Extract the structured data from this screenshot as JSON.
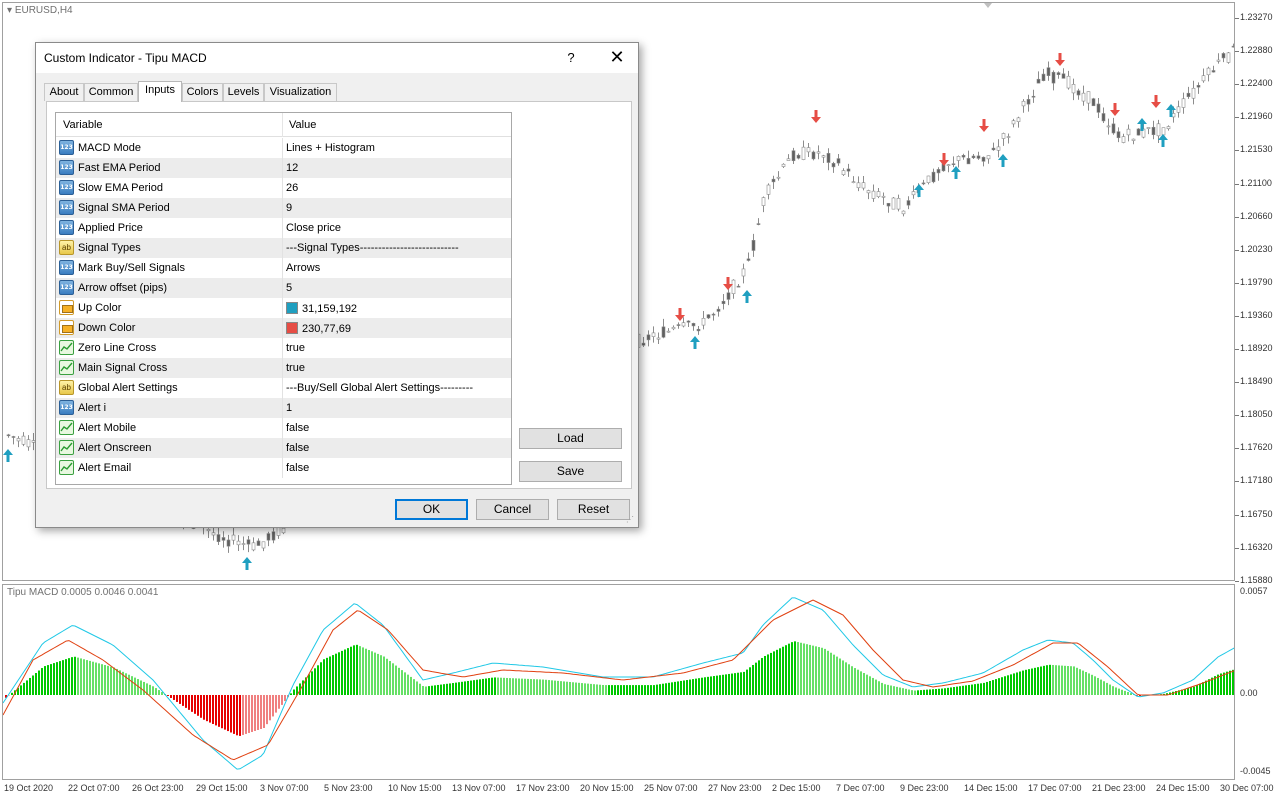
{
  "chart_window": {
    "symbol_label": "EURUSD,H4",
    "indicator_label": "Tipu MACD 0.0005 0.0046 0.0041",
    "price_axis": [
      "1.23270",
      "1.22880",
      "1.22400",
      "1.21960",
      "1.21530",
      "1.21100",
      "1.20660",
      "1.20230",
      "1.19790",
      "1.19360",
      "1.18920",
      "1.18490",
      "1.18050",
      "1.17620",
      "1.17180",
      "1.16750",
      "1.16320",
      "1.15880"
    ],
    "indicator_axis": [
      "0.0057",
      "0.00",
      "-0.0045"
    ],
    "time_axis": [
      "19 Oct 2020",
      "22 Oct 07:00",
      "26 Oct 23:00",
      "29 Oct 15:00",
      "3 Nov 07:00",
      "5 Nov 23:00",
      "10 Nov 15:00",
      "13 Nov 07:00",
      "17 Nov 23:00",
      "20 Nov 15:00",
      "25 Nov 07:00",
      "27 Nov 23:00",
      "2 Dec 15:00",
      "7 Dec 07:00",
      "9 Dec 23:00",
      "14 Dec 15:00",
      "17 Dec 07:00",
      "21 Dec 23:00",
      "24 Dec 15:00",
      "30 Dec 07:00"
    ],
    "colors": {
      "up_arrow": "#1f9fc0",
      "down_arrow": "#e64d45",
      "hist_up_strong": "#00c800",
      "hist_up_weak": "#66e066",
      "hist_down_strong": "#e60000",
      "hist_down_weak": "#f08080",
      "macd_line": "#1fc8e6",
      "signal_line": "#e04010",
      "candles": "#8c8c8c"
    }
  },
  "dialog": {
    "title": "Custom Indicator - Tipu MACD",
    "help_label": "?",
    "close_label": "✕",
    "tabs": [
      {
        "label": "About",
        "active": false
      },
      {
        "label": "Common",
        "active": false
      },
      {
        "label": "Inputs",
        "active": true
      },
      {
        "label": "Colors",
        "active": false
      },
      {
        "label": "Levels",
        "active": false
      },
      {
        "label": "Visualization",
        "active": false
      }
    ],
    "grid": {
      "header_variable": "Variable",
      "header_value": "Value",
      "rows": [
        {
          "icon": "number-icon",
          "variable": "MACD Mode",
          "value": "Lines + Histogram"
        },
        {
          "icon": "number-icon",
          "variable": "Fast EMA Period",
          "value": "12"
        },
        {
          "icon": "number-icon",
          "variable": "Slow EMA Period",
          "value": "26"
        },
        {
          "icon": "number-icon",
          "variable": "Signal SMA Period",
          "value": "9"
        },
        {
          "icon": "number-icon",
          "variable": "Applied Price",
          "value": "Close price"
        },
        {
          "icon": "string-icon",
          "variable": "Signal Types",
          "value": "---Signal Types---------------------------"
        },
        {
          "icon": "number-icon",
          "variable": "Mark Buy/Sell Signals",
          "value": "Arrows"
        },
        {
          "icon": "number-icon",
          "variable": "Arrow offset (pips)",
          "value": "5"
        },
        {
          "icon": "color-icon",
          "variable": "Up Color",
          "value": "31,159,192",
          "swatch": "#1f9fc0"
        },
        {
          "icon": "color-icon",
          "variable": "Down Color",
          "value": "230,77,69",
          "swatch": "#e64d45"
        },
        {
          "icon": "bool-icon",
          "variable": "Zero Line Cross",
          "value": "true"
        },
        {
          "icon": "bool-icon",
          "variable": "Main Signal Cross",
          "value": "true"
        },
        {
          "icon": "string-icon",
          "variable": "Global Alert Settings",
          "value": "---Buy/Sell Global Alert Settings---------"
        },
        {
          "icon": "number-icon",
          "variable": "Alert i",
          "value": "1"
        },
        {
          "icon": "bool-icon",
          "variable": "Alert Mobile",
          "value": "false"
        },
        {
          "icon": "bool-icon",
          "variable": "Alert Onscreen",
          "value": "false"
        },
        {
          "icon": "bool-icon",
          "variable": "Alert Email",
          "value": "false"
        }
      ]
    },
    "buttons": {
      "load": "Load",
      "save": "Save",
      "ok": "OK",
      "cancel": "Cancel",
      "reset": "Reset"
    },
    "icon_glyphs": {
      "number": "123",
      "string": "ab"
    }
  }
}
